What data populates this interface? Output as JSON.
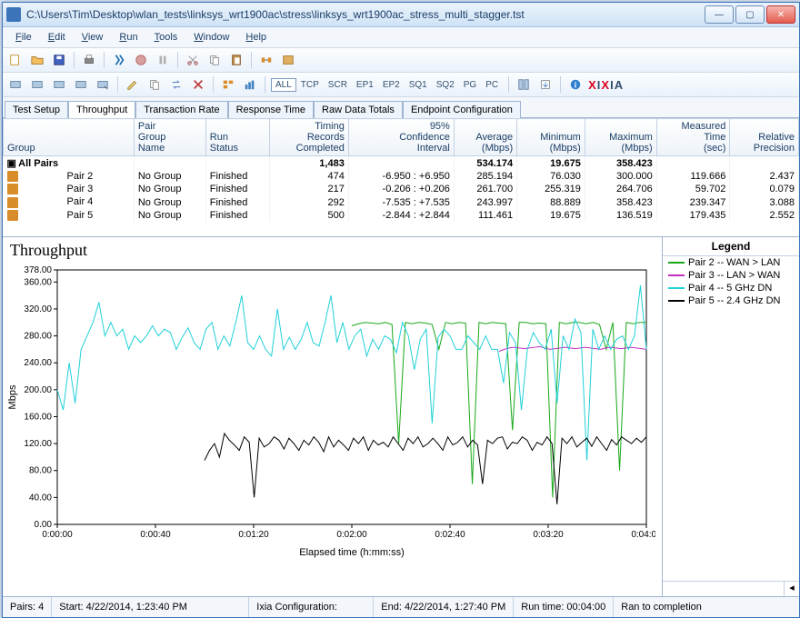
{
  "window": {
    "title": "C:\\Users\\Tim\\Desktop\\wlan_tests\\linksys_wrt1900ac\\stress\\linksys_wrt1900ac_stress_multi_stagger.tst"
  },
  "menu": [
    "File",
    "Edit",
    "View",
    "Run",
    "Tools",
    "Window",
    "Help"
  ],
  "filters": [
    "ALL",
    "TCP",
    "SCR",
    "EP1",
    "EP2",
    "SQ1",
    "SQ2",
    "PG",
    "PC"
  ],
  "brand": "IXIA",
  "tabs": [
    "Test Setup",
    "Throughput",
    "Transaction Rate",
    "Response Time",
    "Raw Data Totals",
    "Endpoint Configuration"
  ],
  "active_tab": 1,
  "table": {
    "headers": [
      "Group",
      "Pair Group Name",
      "Run Status",
      "Timing Records Completed",
      "95% Confidence Interval",
      "Average (Mbps)",
      "Minimum (Mbps)",
      "Maximum (Mbps)",
      "Measured Time (sec)",
      "Relative Precision"
    ],
    "totals": {
      "group": "All Pairs",
      "completed": "1,483",
      "avg": "534.174",
      "min": "19.675",
      "max": "358.423"
    },
    "rows": [
      {
        "group": "Pair 2",
        "pg": "No Group",
        "status": "Finished",
        "completed": "474",
        "ci": "-6.950 : +6.950",
        "avg": "285.194",
        "min": "76.030",
        "max": "300.000",
        "mt": "119.666",
        "rp": "2.437"
      },
      {
        "group": "Pair 3",
        "pg": "No Group",
        "status": "Finished",
        "completed": "217",
        "ci": "-0.206 : +0.206",
        "avg": "261.700",
        "min": "255.319",
        "max": "264.706",
        "mt": "59.702",
        "rp": "0.079"
      },
      {
        "group": "Pair 4",
        "pg": "No Group",
        "status": "Finished",
        "completed": "292",
        "ci": "-7.535 : +7.535",
        "avg": "243.997",
        "min": "88.889",
        "max": "358.423",
        "mt": "239.347",
        "rp": "3.088"
      },
      {
        "group": "Pair 5",
        "pg": "No Group",
        "status": "Finished",
        "completed": "500",
        "ci": "-2.844 : +2.844",
        "avg": "111.461",
        "min": "19.675",
        "max": "136.519",
        "mt": "179.435",
        "rp": "2.552"
      }
    ]
  },
  "chart": {
    "title": "Throughput",
    "xlabel": "Elapsed time (h:mm:ss)",
    "ylabel": "Mbps",
    "legend_title": "Legend",
    "legend": [
      {
        "label": "Pair 2 -- WAN > LAN",
        "color": "#18a818"
      },
      {
        "label": "Pair 3 -- LAN > WAN",
        "color": "#c030c0"
      },
      {
        "label": "Pair 4 -- 5 GHz DN",
        "color": "#20d0d8"
      },
      {
        "label": "Pair 5 -- 2.4 GHz DN",
        "color": "#000000"
      }
    ]
  },
  "chart_data": {
    "type": "line",
    "xlabel": "Elapsed time (h:mm:ss)",
    "ylabel": "Mbps",
    "xlim_sec": [
      0,
      240
    ],
    "ylim": [
      0,
      378
    ],
    "x_ticks_sec": [
      0,
      40,
      80,
      120,
      160,
      200,
      240
    ],
    "x_tick_labels": [
      "0:00:00",
      "0:00:40",
      "0:01:20",
      "0:02:00",
      "0:02:40",
      "0:03:20",
      "0:04:00"
    ],
    "y_ticks": [
      0,
      40,
      80,
      120,
      160,
      200,
      240,
      280,
      320,
      360,
      378
    ],
    "series": [
      {
        "name": "Pair 2 -- WAN > LAN",
        "color": "#18a818",
        "start_sec": 120,
        "end_sec": 240,
        "samples": [
          295,
          298,
          300,
          299,
          298,
          300,
          297,
          120,
          300,
          298,
          300,
          299,
          297,
          260,
          300,
          298,
          300,
          299,
          60,
          300,
          298,
          300,
          299,
          298,
          140,
          300,
          300,
          298,
          299,
          298,
          40,
          300,
          298,
          300,
          300,
          298,
          300,
          297,
          260,
          300,
          80,
          300,
          298,
          300,
          300
        ]
      },
      {
        "name": "Pair 3 -- LAN > WAN",
        "color": "#c030c0",
        "start_sec": 180,
        "end_sec": 240,
        "samples": [
          257,
          260,
          262,
          263,
          262,
          261,
          262,
          263,
          264,
          262,
          260,
          261,
          262,
          263,
          262,
          261,
          262,
          263,
          262,
          261,
          260,
          262,
          263,
          262,
          261,
          262,
          263,
          262,
          261,
          260
        ]
      },
      {
        "name": "Pair 4 -- 5 GHz DN",
        "color": "#20d0d8",
        "start_sec": 0,
        "end_sec": 240,
        "samples": [
          200,
          170,
          240,
          180,
          260,
          280,
          300,
          330,
          280,
          300,
          280,
          290,
          260,
          280,
          270,
          280,
          295,
          280,
          290,
          285,
          260,
          278,
          292,
          270,
          260,
          290,
          300,
          260,
          280,
          265,
          300,
          340,
          270,
          260,
          280,
          260,
          250,
          320,
          260,
          278,
          260,
          275,
          300,
          270,
          265,
          300,
          340,
          270,
          300,
          260,
          280,
          290,
          250,
          275,
          260,
          280,
          275,
          255,
          300,
          280,
          230,
          275,
          290,
          150,
          278,
          290,
          280,
          260,
          260,
          280,
          270,
          260,
          280,
          260,
          260,
          210,
          285,
          270,
          170,
          260,
          285,
          270,
          260,
          290,
          180,
          280,
          260,
          305,
          285,
          95,
          290,
          260,
          280,
          260,
          275,
          280,
          260,
          280,
          355,
          260
        ]
      },
      {
        "name": "Pair 5 -- 2.4 GHz DN",
        "color": "#000000",
        "start_sec": 60,
        "end_sec": 240,
        "samples": [
          95,
          110,
          120,
          100,
          135,
          125,
          118,
          110,
          130,
          122,
          40,
          128,
          115,
          120,
          130,
          125,
          112,
          128,
          120,
          110,
          125,
          118,
          130,
          122,
          108,
          130,
          115,
          125,
          118,
          110,
          128,
          120,
          130,
          110,
          125,
          118,
          122,
          115,
          130,
          120,
          110,
          128,
          120,
          130,
          115,
          120,
          128,
          120,
          110,
          130,
          118,
          122,
          130,
          115,
          125,
          118,
          60,
          125,
          120,
          128,
          130,
          112,
          122,
          120,
          130,
          125,
          110,
          122,
          118,
          130,
          120,
          30,
          128,
          120,
          130,
          115,
          122,
          128,
          116,
          130,
          120,
          110,
          126,
          118,
          130,
          125,
          120,
          128,
          122,
          130
        ]
      }
    ]
  },
  "status": {
    "pairs": "Pairs: 4",
    "start": "Start: 4/22/2014, 1:23:40 PM",
    "config": "Ixia Configuration:",
    "end": "End: 4/22/2014, 1:27:40 PM",
    "runtime": "Run time: 00:04:00",
    "ran": "Ran to completion"
  }
}
